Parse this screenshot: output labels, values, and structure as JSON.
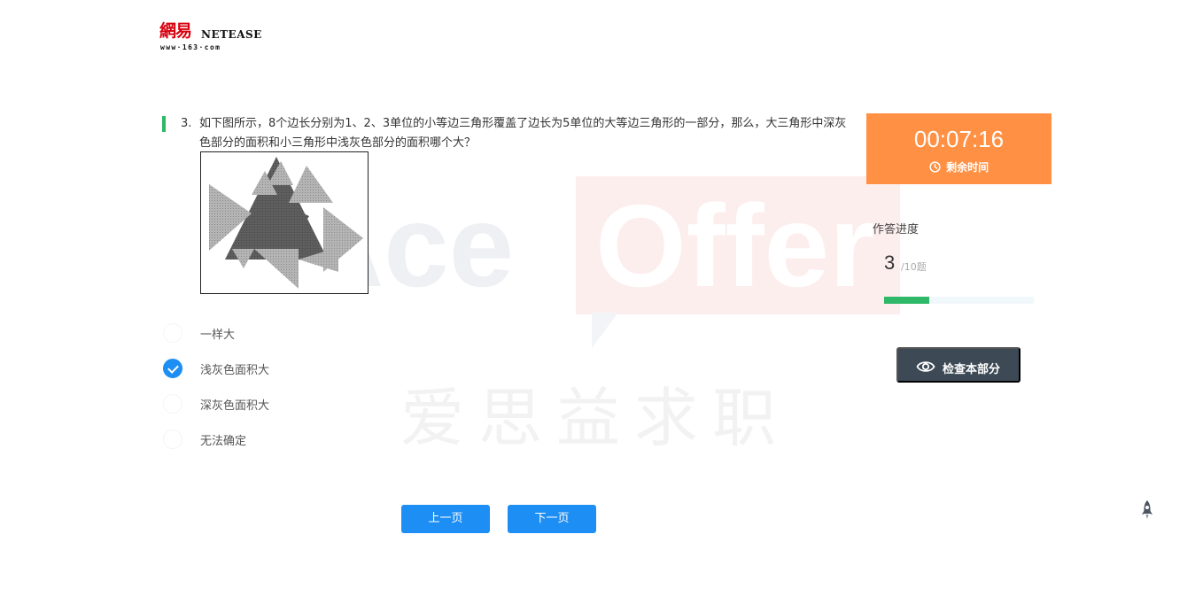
{
  "logo": {
    "cn": "網易",
    "en": "NETEASE",
    "url": "www·163·com"
  },
  "watermark": {
    "brand_left": "Ace",
    "brand_right": "Offer",
    "cn": "爱思益求职"
  },
  "question": {
    "number": "3.",
    "text": "如下图所示，8个边长分别为1、2、3单位的小等边三角形覆盖了边长为5单位的大等边三角形的一部分，那么，大三角形中深灰色部分的面积和小三角形中浅灰色部分的面积哪个大？",
    "options": [
      {
        "label": "一样大",
        "selected": false
      },
      {
        "label": "浅灰色面积大",
        "selected": true
      },
      {
        "label": "深灰色面积大",
        "selected": false
      },
      {
        "label": "无法确定",
        "selected": false
      }
    ]
  },
  "nav": {
    "prev_label": "上一页",
    "next_label": "下一页"
  },
  "timer": {
    "value": "00:07:16",
    "label": "剩余时间"
  },
  "progress": {
    "title": "作答进度",
    "current": "3",
    "total": "/10题",
    "fraction": 0.3
  },
  "check_button": {
    "label": "检查本部分"
  },
  "colors": {
    "accent_blue": "#1d8ef3",
    "timer_orange": "#ff9044",
    "progress_green": "#2eb868",
    "dark_button": "#3d4a56",
    "dark_gray_fill": "#5c5c5c",
    "light_gray_fill": "#a9a9a9"
  },
  "icons": [
    "clock-icon",
    "eye-icon",
    "rocket-icon",
    "check-icon"
  ]
}
